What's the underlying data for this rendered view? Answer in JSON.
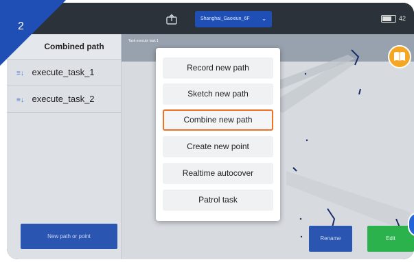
{
  "step_badge": "2",
  "topbar": {
    "map_name": "Shanghai_Gaoxiun_6F",
    "battery_text": "42"
  },
  "sidebar": {
    "title": "Combined path",
    "items": [
      {
        "label": "execute_task_1"
      },
      {
        "label": "execute_task_2"
      }
    ],
    "new_button_label": "New path or point"
  },
  "map": {
    "header_label": "Task execute task 1"
  },
  "menu": {
    "items": [
      {
        "label": "Record new path"
      },
      {
        "label": "Sketch new path"
      },
      {
        "label": "Combine new path"
      },
      {
        "label": "Create new point"
      },
      {
        "label": "Realtime autocover"
      },
      {
        "label": "Patrol task"
      }
    ],
    "highlight_color": "#f07022"
  },
  "footer": {
    "rename_label": "Rename",
    "edit_label": "Edit"
  },
  "colors": {
    "primary": "#1f4fb5",
    "success": "#2bb24c",
    "help": "#f5a623"
  }
}
